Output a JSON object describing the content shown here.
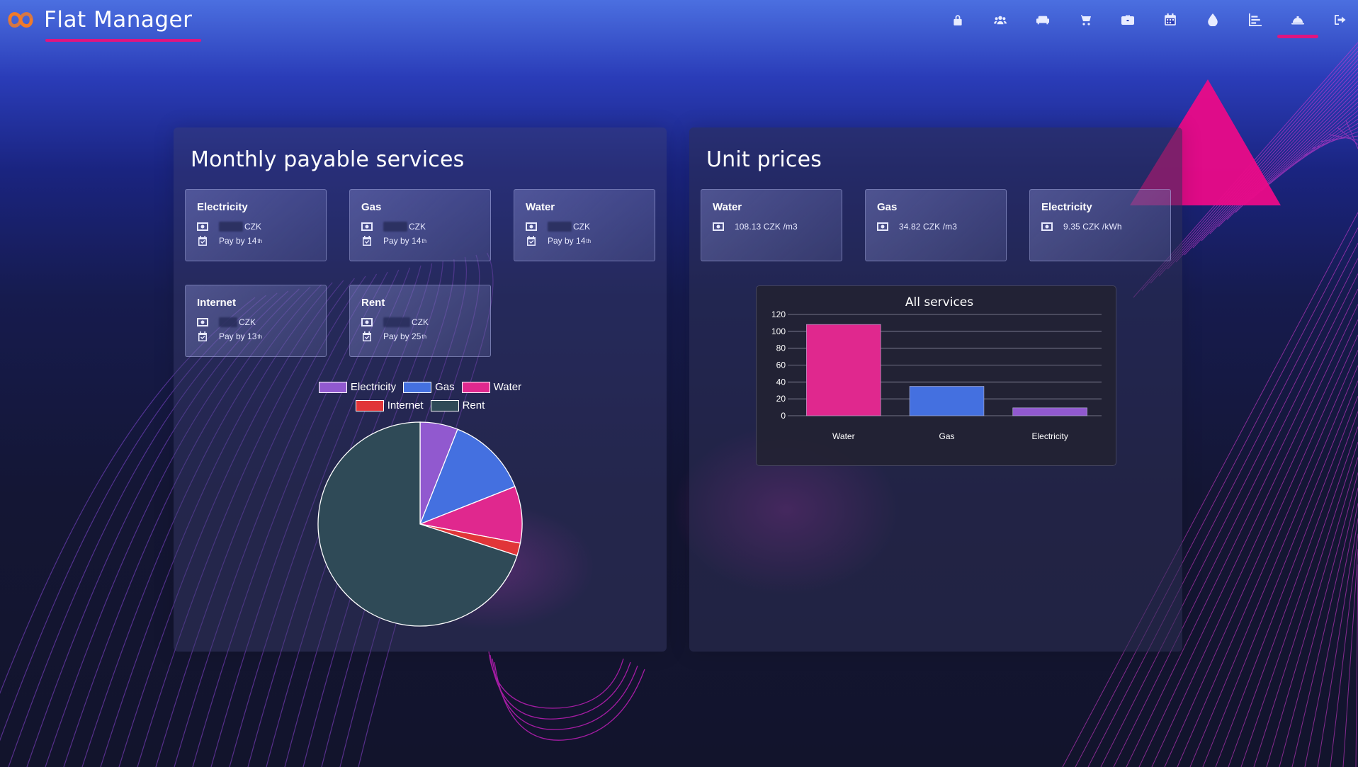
{
  "app": {
    "title": "Flat Manager"
  },
  "nav": {
    "icons": [
      "lock-icon",
      "users-icon",
      "couch-icon",
      "cart-icon",
      "briefcase-icon",
      "calendar-icon",
      "drop-icon",
      "chart-icon",
      "bell-icon",
      "logout-icon"
    ],
    "active": "bell-icon"
  },
  "colors": {
    "accent": "#e0157f",
    "electricity": "#9159cf",
    "gas": "#4470e0",
    "water": "#e0288e",
    "internet": "#e13538",
    "rent": "#2f4a57"
  },
  "monthly": {
    "title": "Monthly payable services",
    "cards": [
      {
        "name": "Electricity",
        "currency": "CZK",
        "pay_prefix": "Pay by ",
        "pay_day": "14",
        "suffix": "th"
      },
      {
        "name": "Gas",
        "currency": "CZK",
        "pay_prefix": "Pay by ",
        "pay_day": "14",
        "suffix": "th"
      },
      {
        "name": "Water",
        "currency": "CZK",
        "pay_prefix": "Pay by ",
        "pay_day": "14",
        "suffix": "th"
      },
      {
        "name": "Internet",
        "currency": "CZK",
        "pay_prefix": "Pay by ",
        "pay_day": "13",
        "suffix": "th"
      },
      {
        "name": "Rent",
        "currency": "CZK",
        "pay_prefix": "Pay by ",
        "pay_day": "25",
        "suffix": "th"
      }
    ]
  },
  "unit_prices": {
    "title": "Unit prices",
    "cards": [
      {
        "name": "Water",
        "price": "108.13 CZK /m3"
      },
      {
        "name": "Gas",
        "price": "34.82 CZK /m3"
      },
      {
        "name": "Electricity",
        "price": "9.35 CZK /kWh"
      }
    ]
  },
  "chart_data": [
    {
      "type": "pie",
      "categories": [
        "Electricity",
        "Gas",
        "Water",
        "Internet",
        "Rent"
      ],
      "values": [
        6,
        13,
        9,
        2,
        70
      ],
      "legend": "top"
    },
    {
      "type": "bar",
      "title": "All services",
      "categories": [
        "Water",
        "Gas",
        "Electricity"
      ],
      "values": [
        108.13,
        34.82,
        9.35
      ],
      "ylim": [
        0,
        120
      ],
      "yticks": [
        0,
        20,
        40,
        60,
        80,
        100,
        120
      ],
      "grid": true,
      "legend": "none"
    }
  ]
}
